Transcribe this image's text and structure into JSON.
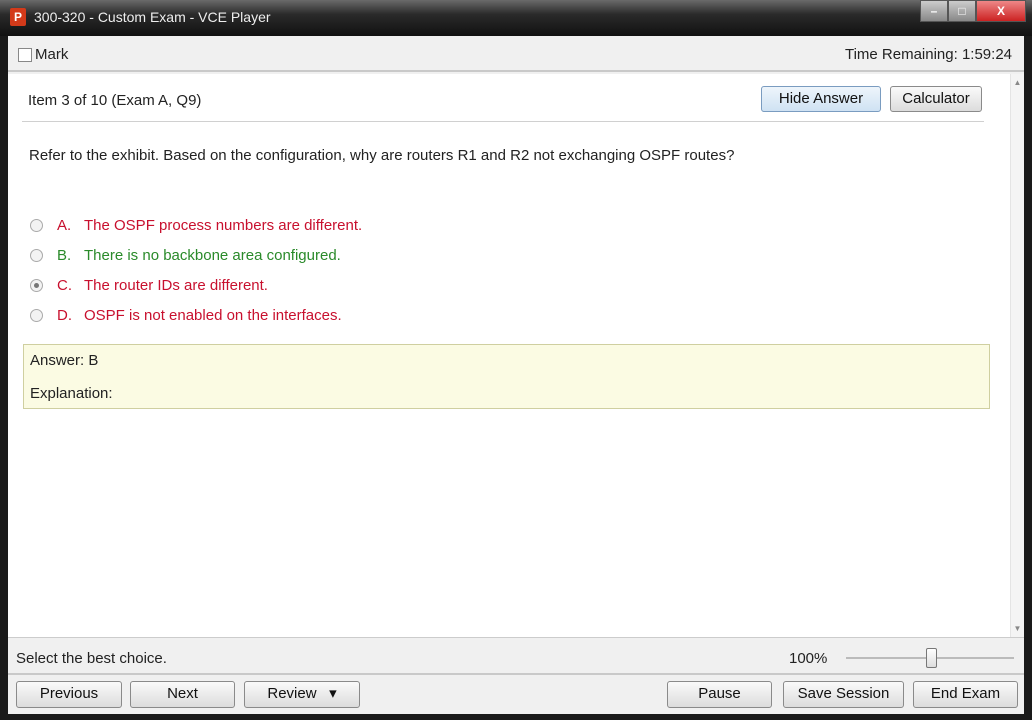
{
  "window": {
    "title": "300-320 - Custom Exam - VCE Player",
    "icon_letter": "P",
    "minimize": "–",
    "maximize": "□",
    "close": "X"
  },
  "toolbar": {
    "mark_label": "Mark",
    "time_remaining": "Time Remaining: 1:59:24"
  },
  "question": {
    "item": "Item 3 of 10  (Exam A, Q9)",
    "hide_answer": "Hide Answer",
    "calculator": "Calculator",
    "text": "Refer to the exhibit. Based on the configuration, why are routers R1 and R2 not exchanging OSPF routes?",
    "options": [
      {
        "letter": "A.",
        "text": "The OSPF process numbers are different.",
        "color": "#c8102e",
        "selected": false
      },
      {
        "letter": "B.",
        "text": "There is no backbone area configured.",
        "color": "#2a8a2a",
        "selected": false
      },
      {
        "letter": "C.",
        "text": "The router IDs are different.",
        "color": "#c8102e",
        "selected": true
      },
      {
        "letter": "D.",
        "text": "OSPF is not enabled on the interfaces.",
        "color": "#c8102e",
        "selected": false
      }
    ],
    "answer": "Answer: B",
    "explanation": "Explanation:"
  },
  "status": {
    "message": "Select the best choice.",
    "zoom": "100%",
    "zoom_level_percent": 100
  },
  "buttons": {
    "previous": "Previous",
    "next": "Next",
    "review": "Review",
    "review_arrow": "▾",
    "pause": "Pause",
    "save_session": "Save Session",
    "end_exam": "End Exam"
  }
}
